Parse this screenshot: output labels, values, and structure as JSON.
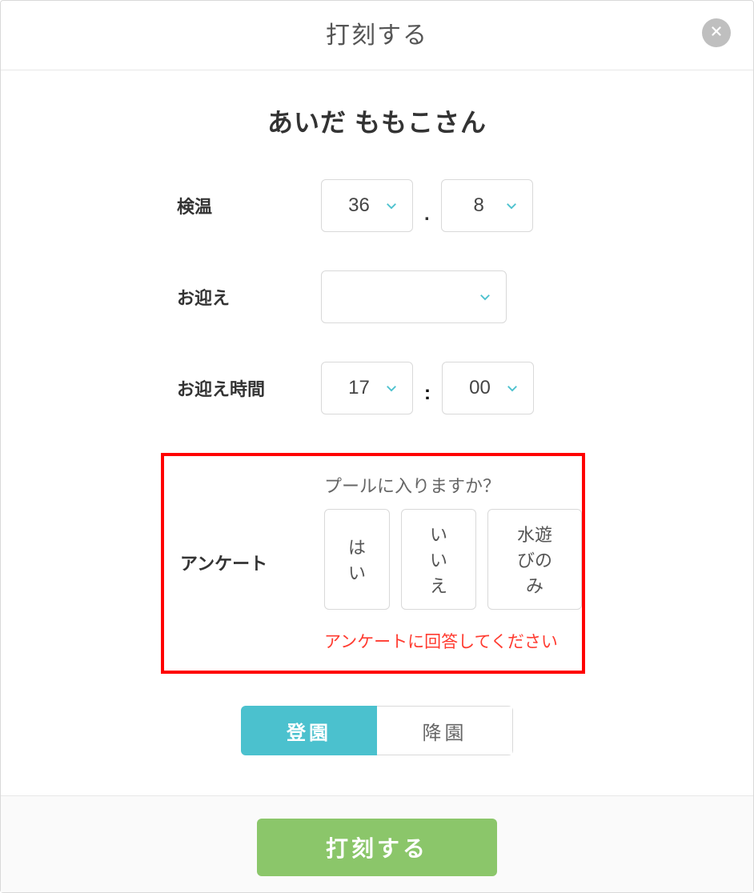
{
  "header": {
    "title": "打刻する"
  },
  "person": {
    "name": "あいだ ももこさん"
  },
  "form": {
    "temperature": {
      "label": "検温",
      "whole": "36",
      "decimal": "8",
      "separator": "."
    },
    "pickup": {
      "label": "お迎え",
      "value": ""
    },
    "pickup_time": {
      "label": "お迎え時間",
      "hour": "17",
      "minute": "00",
      "separator": ":"
    },
    "survey": {
      "label": "アンケート",
      "question": "プールに入りますか？",
      "options": [
        "はい",
        "いいえ",
        "水遊びのみ"
      ],
      "error": "アンケートに回答してください"
    },
    "toggle": {
      "option_a": "登園",
      "option_b": "降園",
      "active": "option_a"
    }
  },
  "footer": {
    "submit": "打刻する"
  }
}
